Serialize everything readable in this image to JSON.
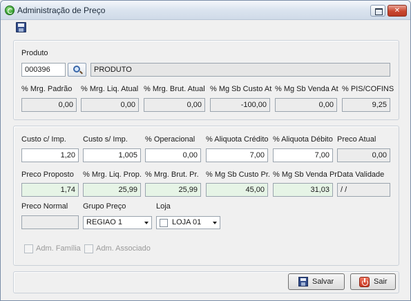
{
  "window": {
    "title": "Administração de Preço"
  },
  "produto": {
    "label": "Produto",
    "code": "000396",
    "name": "PRODUTO"
  },
  "margins_top": {
    "labels": [
      "% Mrg. Padrão",
      "% Mrg. Liq. Atual",
      "% Mrg. Brut. Atual",
      "% Mg Sb Custo At",
      "% Mg Sb Venda At",
      "% PIS/COFINS"
    ],
    "values": [
      "0,00",
      "0,00",
      "0,00",
      "-100,00",
      "0,00",
      "9,25"
    ]
  },
  "costs": {
    "labels": [
      "Custo c/ Imp.",
      "Custo s/ Imp.",
      "% Operacional",
      "% Aliquota Crédito",
      "% Aliquota Débito",
      "Preco Atual"
    ],
    "values": [
      "1,20",
      "1,005",
      "0,00",
      "7,00",
      "7,00",
      "0,00"
    ]
  },
  "proposal": {
    "labels": [
      "Preco Proposto",
      "% Mrg. Liq. Prop.",
      "% Mrg. Brut. Pr.",
      "% Mg Sb Custo Pr.",
      "% Mg Sb Venda Pr",
      "Data Validade"
    ],
    "values": [
      "1,74",
      "25,99",
      "25,99",
      "45,00",
      "31,03",
      " / /"
    ]
  },
  "preco_normal": {
    "label": "Preco Normal",
    "value": ""
  },
  "grupo_preco": {
    "label": "Grupo Preço",
    "selected": "REGIAO 1"
  },
  "loja": {
    "label": "Loja",
    "selected": "LOJA 01"
  },
  "checkboxes": {
    "adm_familia": "Adm. Família",
    "adm_associado": "Adm. Associado"
  },
  "buttons": {
    "save": "Salvar",
    "exit": "Sair"
  },
  "colors": {
    "field_bg": "#ececec",
    "field_green": "#e6f4e6",
    "close_red": "#c9462f"
  }
}
